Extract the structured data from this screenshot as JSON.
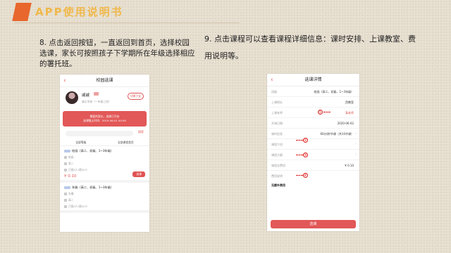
{
  "slide": {
    "title": "APP使用说明书",
    "note8": "8. 点击返回按钮，一直返回到首页，选择校园选课，家长可按照孩子下学期所在年级选择相应的署托班。",
    "note9": "9. 点击课程可以查看课程详细信息：课时安排、上课教室、费用说明等。"
  },
  "left_screen": {
    "nav_title": "校园选课",
    "profile_name": "戚戚",
    "profile_sub": "演示学校（一年级三班）",
    "switch_btn": "切换子女",
    "banner_line1": "敬爱的家长，选课已开启",
    "banner_line2": "选课截止时间：2019-06-01 00:00",
    "search_label": "搜索",
    "filter1": "全部等级",
    "filter2": "全部课程类目",
    "items": [
      {
        "title": "绘画（高二、初级、1~3年级）",
        "m1": "绘画",
        "m2": "高二",
        "m3": "已报0人/限20人",
        "price": "¥ 0.10",
        "btn": "选课"
      },
      {
        "title": "东雅（高二、初级、1~3年级）",
        "m1": "东雅",
        "m2": "高二",
        "m3": "已报0人/限20人"
      }
    ]
  },
  "right_screen": {
    "nav_title": "选课详情",
    "rows": [
      {
        "label": "班级",
        "value": "绘画（高二、初级、1~3年级）"
      },
      {
        "label": "上课地址",
        "value": "西教室"
      },
      {
        "label": "上课老师",
        "value": "泰老师"
      },
      {
        "label": "开课日期",
        "value": "2020-06-02"
      },
      {
        "label": "课时信息",
        "value": "60分钟/节课（共10节课）"
      },
      {
        "label": "课程介绍",
        "value": ""
      },
      {
        "label": "课程大纲",
        "value": ""
      },
      {
        "label": "课程总费用",
        "value": "¥ 0.10"
      },
      {
        "label": "费用说明",
        "value": ""
      }
    ],
    "extra": "无额外费用",
    "button": "选课",
    "callouts": [
      "①",
      "②",
      "③",
      "④"
    ]
  }
}
